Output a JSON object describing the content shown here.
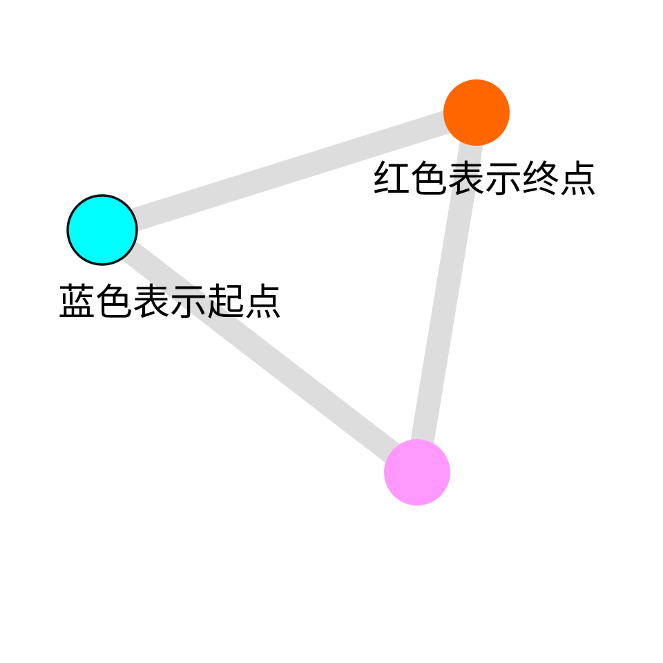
{
  "graph": {
    "edge_color": "#dddddd",
    "nodes": [
      {
        "id": "start",
        "color": "#00ffff",
        "outline": "#111111",
        "label": "蓝色表示起点"
      },
      {
        "id": "end",
        "color": "#ff6600",
        "outline": "",
        "label": "红色表示终点"
      },
      {
        "id": "middle",
        "color": "#ff99ff",
        "outline": "",
        "label": ""
      }
    ],
    "edges": [
      {
        "from": "start",
        "to": "end"
      },
      {
        "from": "end",
        "to": "middle"
      },
      {
        "from": "start",
        "to": "middle"
      }
    ]
  }
}
